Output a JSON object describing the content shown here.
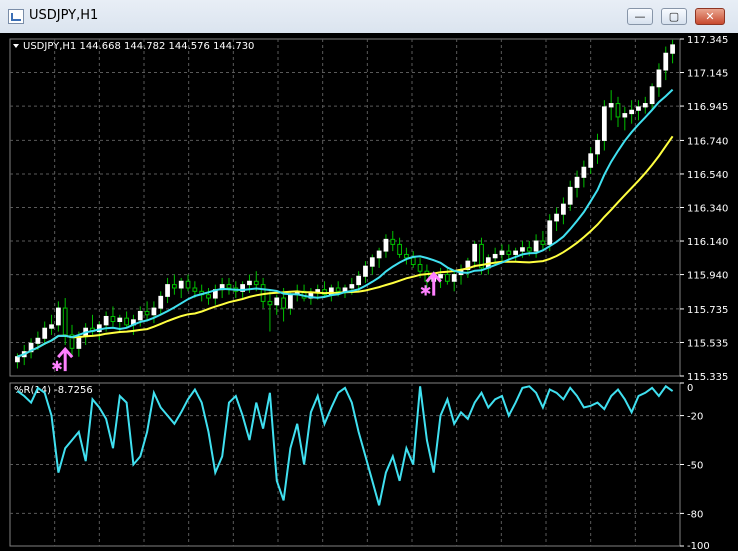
{
  "window": {
    "title": "USDJPY,H1",
    "buttons": {
      "minimize": "—",
      "maximize": "▢",
      "close": "✕"
    }
  },
  "chart_data": [
    {
      "type": "candlestick",
      "title": "USDJPY,H1 144.668 144.782 144.576 144.730",
      "ylim": [
        115.335,
        117.345
      ],
      "yticks": [
        "117.345",
        "117.145",
        "116.945",
        "116.740",
        "116.540",
        "116.340",
        "116.140",
        "115.940",
        "115.735",
        "115.535",
        "115.335"
      ],
      "grid": true,
      "colors": {
        "up": "#ffffff",
        "down": "#ffffff",
        "wick": "#00c000",
        "ma_fast": "#40e0f0",
        "ma_slow": "#ffff40",
        "arrow": "#ff80ff"
      },
      "candles": [
        [
          115.42,
          115.47,
          115.38,
          115.45
        ],
        [
          115.45,
          115.52,
          115.4,
          115.48
        ],
        [
          115.48,
          115.56,
          115.44,
          115.53
        ],
        [
          115.53,
          115.6,
          115.49,
          115.56
        ],
        [
          115.56,
          115.66,
          115.52,
          115.62
        ],
        [
          115.62,
          115.7,
          115.58,
          115.64
        ],
        [
          115.64,
          115.78,
          115.6,
          115.74
        ],
        [
          115.74,
          115.8,
          115.52,
          115.58
        ],
        [
          115.58,
          115.64,
          115.46,
          115.5
        ],
        [
          115.5,
          115.6,
          115.45,
          115.57
        ],
        [
          115.57,
          115.65,
          115.52,
          115.62
        ],
        [
          115.62,
          115.7,
          115.57,
          115.6
        ],
        [
          115.6,
          115.66,
          115.55,
          115.64
        ],
        [
          115.64,
          115.72,
          115.6,
          115.69
        ],
        [
          115.69,
          115.75,
          115.63,
          115.66
        ],
        [
          115.66,
          115.7,
          115.6,
          115.68
        ],
        [
          115.68,
          115.72,
          115.62,
          115.64
        ],
        [
          115.64,
          115.7,
          115.58,
          115.67
        ],
        [
          115.67,
          115.75,
          115.63,
          115.72
        ],
        [
          115.72,
          115.78,
          115.66,
          115.7
        ],
        [
          115.7,
          115.78,
          115.65,
          115.74
        ],
        [
          115.74,
          115.84,
          115.7,
          115.81
        ],
        [
          115.81,
          115.92,
          115.77,
          115.88
        ],
        [
          115.88,
          115.94,
          115.82,
          115.86
        ],
        [
          115.86,
          115.92,
          115.8,
          115.9
        ],
        [
          115.9,
          115.94,
          115.84,
          115.86
        ],
        [
          115.86,
          115.9,
          115.8,
          115.84
        ],
        [
          115.84,
          115.88,
          115.78,
          115.82
        ],
        [
          115.82,
          115.86,
          115.76,
          115.8
        ],
        [
          115.8,
          115.88,
          115.76,
          115.85
        ],
        [
          115.85,
          115.92,
          115.8,
          115.88
        ],
        [
          115.88,
          115.92,
          115.82,
          115.86
        ],
        [
          115.86,
          115.9,
          115.8,
          115.84
        ],
        [
          115.84,
          115.9,
          115.8,
          115.88
        ],
        [
          115.88,
          115.94,
          115.83,
          115.9
        ],
        [
          115.9,
          115.96,
          115.84,
          115.88
        ],
        [
          115.88,
          115.92,
          115.74,
          115.78
        ],
        [
          115.78,
          115.84,
          115.6,
          115.76
        ],
        [
          115.76,
          115.82,
          115.7,
          115.8
        ],
        [
          115.8,
          115.86,
          115.66,
          115.74
        ],
        [
          115.74,
          115.84,
          115.7,
          115.82
        ],
        [
          115.82,
          115.88,
          115.78,
          115.84
        ],
        [
          115.84,
          115.88,
          115.78,
          115.8
        ],
        [
          115.8,
          115.86,
          115.76,
          115.83
        ],
        [
          115.83,
          115.88,
          115.79,
          115.85
        ],
        [
          115.85,
          115.9,
          115.8,
          115.82
        ],
        [
          115.82,
          115.88,
          115.78,
          115.86
        ],
        [
          115.86,
          115.9,
          115.81,
          115.84
        ],
        [
          115.84,
          115.88,
          115.8,
          115.86
        ],
        [
          115.86,
          115.92,
          115.82,
          115.88
        ],
        [
          115.88,
          115.96,
          115.84,
          115.93
        ],
        [
          115.93,
          116.02,
          115.89,
          115.99
        ],
        [
          115.99,
          116.06,
          115.94,
          116.04
        ],
        [
          116.04,
          116.1,
          115.98,
          116.08
        ],
        [
          116.08,
          116.18,
          116.04,
          116.15
        ],
        [
          116.15,
          116.2,
          116.08,
          116.12
        ],
        [
          116.12,
          116.16,
          116.04,
          116.06
        ],
        [
          116.06,
          116.1,
          116.0,
          116.04
        ],
        [
          116.04,
          116.08,
          115.98,
          116.0
        ],
        [
          116.0,
          116.04,
          115.92,
          115.96
        ],
        [
          115.96,
          116.0,
          115.86,
          115.9
        ],
        [
          115.9,
          115.96,
          115.84,
          115.92
        ],
        [
          115.92,
          115.98,
          115.86,
          115.94
        ],
        [
          115.94,
          115.98,
          115.88,
          115.9
        ],
        [
          115.9,
          115.96,
          115.84,
          115.94
        ],
        [
          115.94,
          116.0,
          115.88,
          115.97
        ],
        [
          115.97,
          116.04,
          115.92,
          116.02
        ],
        [
          116.02,
          116.14,
          115.98,
          116.12
        ],
        [
          116.12,
          116.16,
          115.94,
          115.98
        ],
        [
          115.98,
          116.06,
          115.94,
          116.04
        ],
        [
          116.04,
          116.1,
          116.0,
          116.06
        ],
        [
          116.06,
          116.12,
          116.02,
          116.08
        ],
        [
          116.08,
          116.12,
          116.03,
          116.06
        ],
        [
          116.06,
          116.1,
          116.02,
          116.08
        ],
        [
          116.08,
          116.14,
          116.04,
          116.1
        ],
        [
          116.1,
          116.14,
          116.05,
          116.08
        ],
        [
          116.08,
          116.18,
          116.04,
          116.14
        ],
        [
          116.14,
          116.2,
          116.08,
          116.12
        ],
        [
          116.12,
          116.3,
          116.08,
          116.26
        ],
        [
          116.26,
          116.34,
          116.2,
          116.3
        ],
        [
          116.3,
          116.4,
          116.24,
          116.36
        ],
        [
          116.36,
          116.5,
          116.32,
          116.46
        ],
        [
          116.46,
          116.56,
          116.4,
          116.52
        ],
        [
          116.52,
          116.62,
          116.46,
          116.58
        ],
        [
          116.58,
          116.7,
          116.54,
          116.66
        ],
        [
          116.66,
          116.78,
          116.6,
          116.74
        ],
        [
          116.74,
          116.98,
          116.68,
          116.94
        ],
        [
          116.94,
          117.04,
          116.86,
          116.96
        ],
        [
          116.96,
          117.0,
          116.82,
          116.88
        ],
        [
          116.88,
          116.94,
          116.8,
          116.9
        ],
        [
          116.9,
          116.98,
          116.84,
          116.92
        ],
        [
          116.92,
          116.98,
          116.86,
          116.94
        ],
        [
          116.94,
          117.0,
          116.9,
          116.96
        ],
        [
          116.96,
          117.08,
          116.92,
          117.06
        ],
        [
          117.06,
          117.2,
          117.0,
          117.16
        ],
        [
          117.16,
          117.3,
          117.1,
          117.26
        ],
        [
          117.26,
          117.34,
          117.2,
          117.31
        ]
      ],
      "annotations": [
        "up arrow",
        "up arrow"
      ]
    },
    {
      "type": "line",
      "title": "%R(14) -8.7256",
      "ylim": [
        -100,
        0
      ],
      "yticks": [
        "0",
        "-20",
        "-50",
        "-80",
        "-100"
      ],
      "values": [
        -5,
        -8,
        -12,
        -3,
        -6,
        -20,
        -55,
        -40,
        -35,
        -30,
        -48,
        -10,
        -15,
        -22,
        -40,
        -8,
        -12,
        -50,
        -45,
        -30,
        -6,
        -15,
        -20,
        -25,
        -18,
        -10,
        -4,
        -12,
        -30,
        -55,
        -45,
        -12,
        -8,
        -20,
        -35,
        -12,
        -28,
        -6,
        -60,
        -72,
        -40,
        -25,
        -50,
        -18,
        -8,
        -25,
        -15,
        -6,
        -3,
        -12,
        -30,
        -45,
        -60,
        -75,
        -55,
        -45,
        -60,
        -40,
        -50,
        -2,
        -35,
        -55,
        -20,
        -10,
        -25,
        -18,
        -22,
        -12,
        -6,
        -15,
        -10,
        -8,
        -20,
        -12,
        -3,
        -2,
        -6,
        -15,
        -4,
        -6,
        -10,
        -3,
        -8,
        -15,
        -14,
        -12,
        -16,
        -8,
        -4,
        -10,
        -18,
        -8,
        -6,
        -3,
        -8,
        -2,
        -5
      ]
    }
  ]
}
